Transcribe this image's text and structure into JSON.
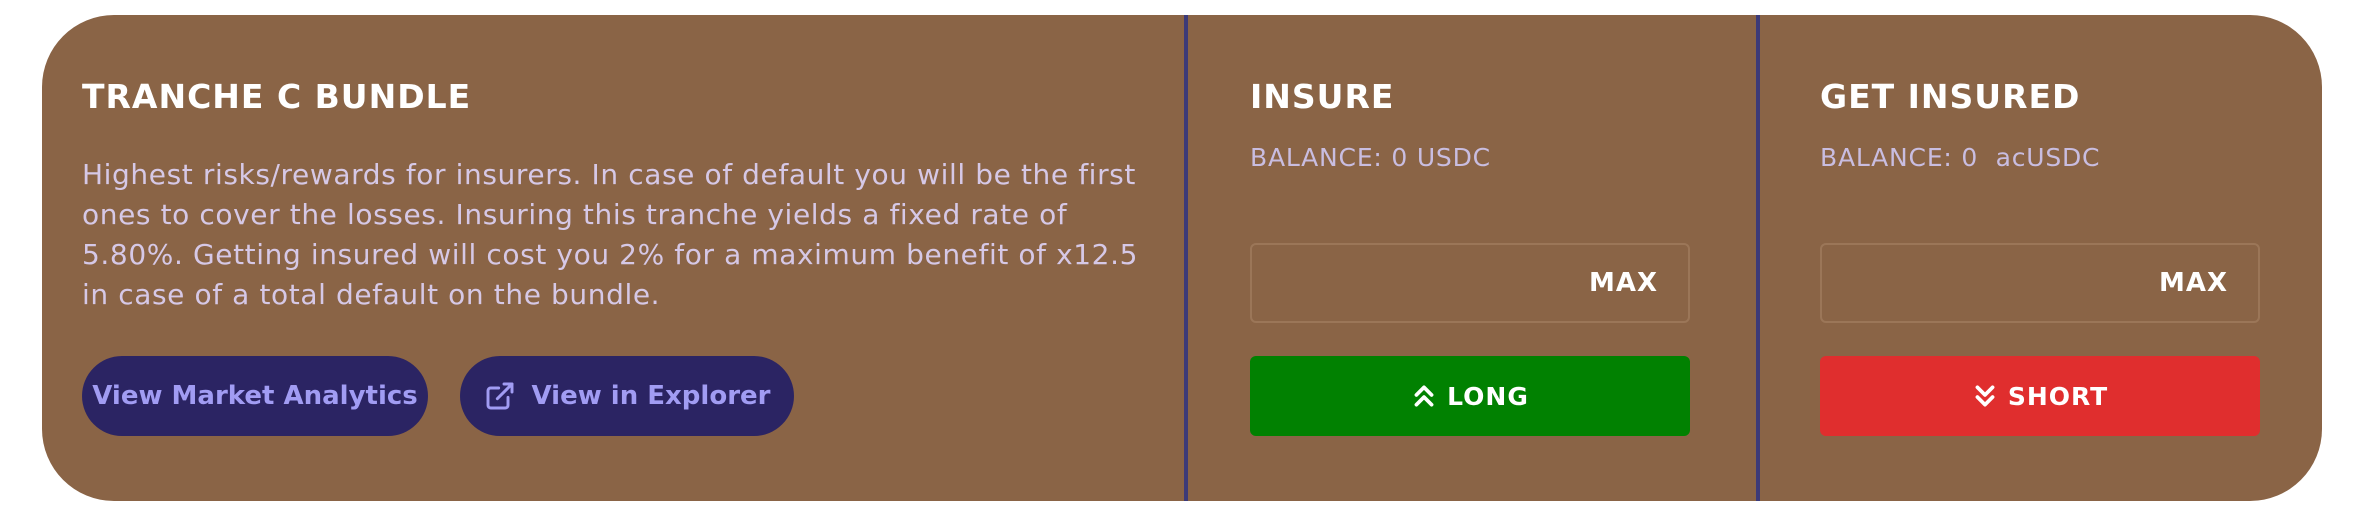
{
  "bundle": {
    "title": "TRANCHE C BUNDLE",
    "description": "Highest risks/rewards for insurers. In case of default you will be the first ones to cover the losses. Insuring this tranche yields a fixed rate of 5.80%. Getting insured will cost you 2% for a maximum benefit of x12.5 in case of a total default on the bundle.",
    "analytics_label": "View Market Analytics",
    "explorer_label": "View in Explorer"
  },
  "insure": {
    "title": "INSURE",
    "balance": "BALANCE: 0 USDC",
    "input_value": "",
    "max_label": "MAX",
    "action_label": "LONG"
  },
  "get_insured": {
    "title": "GET INSURED",
    "balance": "BALANCE: 0  acUSDC",
    "input_value": "",
    "max_label": "MAX",
    "action_label": "SHORT"
  },
  "colors": {
    "card_background": "#8a6446",
    "divider": "#3c3a78",
    "pill_background": "#2b2463",
    "pill_text": "#a19cf3",
    "long_button": "#018101",
    "short_button": "#e02e2e"
  },
  "icons": {
    "explorer": "external-link-icon",
    "long": "chevrons-up-icon",
    "short": "chevrons-down-icon"
  }
}
